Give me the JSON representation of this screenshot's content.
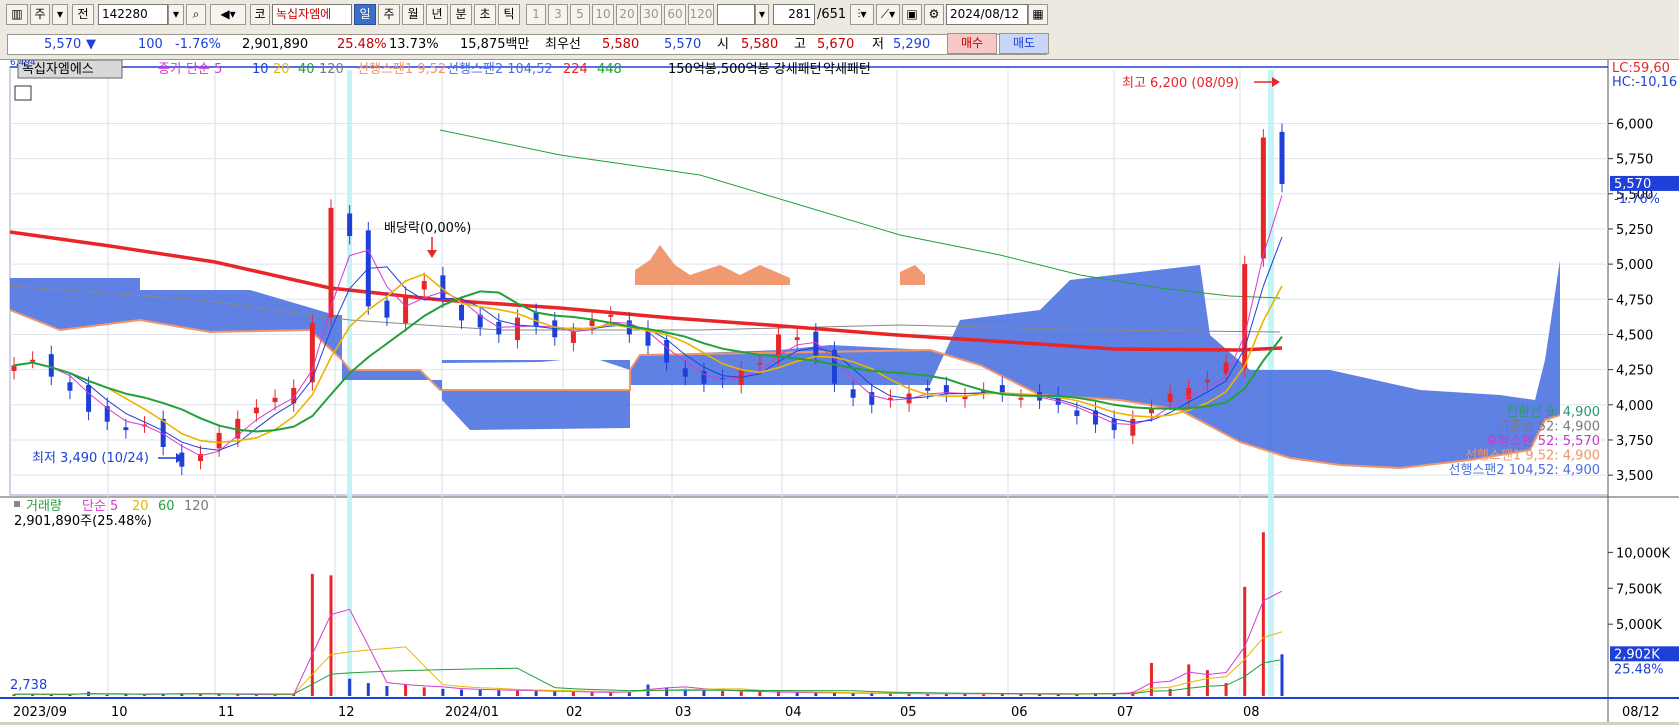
{
  "toolbar": {
    "period_label": "주",
    "code_value": "142280",
    "market_label": "코",
    "stock_name": "녹십자엠에",
    "ranges": [
      "일",
      "주",
      "월",
      "년",
      "분",
      "초",
      "틱"
    ],
    "active_range": "일",
    "minute_steps": [
      "1",
      "3",
      "5",
      "10",
      "20",
      "30",
      "60",
      "120"
    ],
    "page_count": "281",
    "page_total": "/651",
    "date": "2024/08/12"
  },
  "quote": {
    "price": "5,570",
    "arrow": "▼",
    "change": "100",
    "change_pct": "-1.76%",
    "volume": "2,901,890",
    "volume_pct": "25.48%",
    "turnover_pct": "13.73%",
    "amount": "15,875백만",
    "bid_label": "최우선",
    "bid1": "5,580",
    "bid2": "5,570",
    "open_label": "시",
    "open": "5,580",
    "high_label": "고",
    "high": "5,670",
    "low_label": "저",
    "low": "5,290",
    "buy_button": "매수",
    "sell_button": "매도"
  },
  "colors": {
    "up": "#e8262a",
    "down": "#1e40d8",
    "cloud": "#4a6fe0",
    "cloud_up": "#f0956a",
    "ma_red": "#e8262a",
    "ma_green": "#22a03a",
    "ma_yellow": "#e9b500",
    "ma_blue": "#1e40d8",
    "ma_pink": "#d63bd0"
  },
  "chart_data": {
    "type": "candlestick",
    "title": "녹십자엠에스",
    "legend": [
      "종가 단순 5",
      "10",
      "20",
      "40",
      "120",
      "선행스팬1 9,52",
      "선행스팬2 104,52",
      "224",
      "448",
      "150억봉,500억봉 강세패턴",
      "약세패턴"
    ],
    "price_axis_ticks": [
      "6,000",
      "5,750",
      "5,500",
      "5,250",
      "5,000",
      "4,750",
      "4,500",
      "4,250",
      "4,000",
      "3,750",
      "3,500"
    ],
    "price_ylim": [
      3380,
      6380
    ],
    "x_labels": [
      "2023/09",
      "10",
      "11",
      "12",
      "2024/01",
      "02",
      "03",
      "04",
      "05",
      "06",
      "07",
      "08",
      "08/12"
    ],
    "annotations": {
      "high": "최고 6,200 (08/09)",
      "low": "최저 3,490 (10/24)",
      "dividend": "배당락(0,00%)",
      "lc": "LC:59,60",
      "hc": "HC:-10,16",
      "price_tag": "5,570",
      "price_pct": "-1.76%",
      "top_left": "6,494"
    },
    "ichimoku_labels": [
      {
        "text": "전환선 9: 4,900",
        "color": "#2a9a6a"
      },
      {
        "text": "기준선 52: 4,900",
        "color": "#7a7a7a"
      },
      {
        "text": "후행스팬 52: 5,570",
        "color": "#c83ac8"
      },
      {
        "text": "선행스팬1 9,52: 4,900",
        "color": "#f0956a"
      },
      {
        "text": "선행스팬2 104,52: 4,900",
        "color": "#4a6fe0"
      }
    ],
    "close_series": [
      4280,
      4320,
      4200,
      4100,
      3950,
      3880,
      3820,
      3860,
      3700,
      3560,
      3650,
      3800,
      3900,
      3980,
      4050,
      4120,
      4580,
      5400,
      5200,
      4700,
      4620,
      4780,
      4880,
      4750,
      4600,
      4550,
      4500,
      4620,
      4560,
      4480,
      4520,
      4600,
      4640,
      4500,
      4420,
      4300,
      4200,
      4150,
      4180,
      4250,
      4300,
      4500,
      4480,
      4350,
      4150,
      4050,
      4000,
      4050,
      4080,
      4100,
      4080,
      4060,
      4100,
      4080,
      4050,
      4030,
      4000,
      3920,
      3860,
      3820,
      3900,
      3980,
      4080,
      4120,
      4180,
      4300,
      5000,
      5900,
      5570
    ],
    "volume_panel": {
      "legend": [
        "거래량",
        "단순 5",
        "20",
        "60",
        "120"
      ],
      "current_label": "2,901,890주(25.48%)",
      "ticks": [
        "10,000K",
        "7,500K",
        "5,000K"
      ],
      "vol_tag": "2,902K",
      "vol_pct": "25.48%",
      "min_label": "2,738",
      "ylim": [
        0,
        11000
      ],
      "values": [
        120,
        140,
        110,
        90,
        300,
        80,
        100,
        130,
        160,
        200,
        150,
        120,
        110,
        90,
        100,
        130,
        8500,
        8400,
        1200,
        900,
        700,
        800,
        600,
        500,
        450,
        420,
        400,
        380,
        350,
        300,
        280,
        260,
        250,
        300,
        800,
        600,
        500,
        400,
        350,
        300,
        280,
        260,
        240,
        220,
        200,
        190,
        180,
        170,
        160,
        150,
        160,
        170,
        150,
        140,
        130,
        120,
        110,
        150,
        200,
        180,
        300,
        2300,
        500,
        2200,
        1800,
        900,
        7600,
        11400,
        2902
      ]
    }
  }
}
